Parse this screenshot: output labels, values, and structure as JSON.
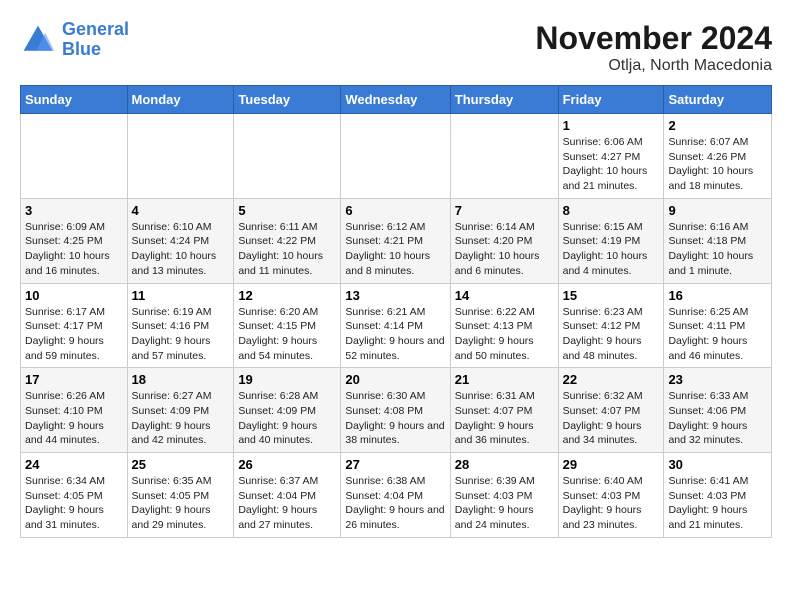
{
  "logo": {
    "line1": "General",
    "line2": "Blue"
  },
  "title": "November 2024",
  "location": "Otlja, North Macedonia",
  "days_of_week": [
    "Sunday",
    "Monday",
    "Tuesday",
    "Wednesday",
    "Thursday",
    "Friday",
    "Saturday"
  ],
  "weeks": [
    [
      {
        "day": "",
        "info": ""
      },
      {
        "day": "",
        "info": ""
      },
      {
        "day": "",
        "info": ""
      },
      {
        "day": "",
        "info": ""
      },
      {
        "day": "",
        "info": ""
      },
      {
        "day": "1",
        "info": "Sunrise: 6:06 AM\nSunset: 4:27 PM\nDaylight: 10 hours and 21 minutes."
      },
      {
        "day": "2",
        "info": "Sunrise: 6:07 AM\nSunset: 4:26 PM\nDaylight: 10 hours and 18 minutes."
      }
    ],
    [
      {
        "day": "3",
        "info": "Sunrise: 6:09 AM\nSunset: 4:25 PM\nDaylight: 10 hours and 16 minutes."
      },
      {
        "day": "4",
        "info": "Sunrise: 6:10 AM\nSunset: 4:24 PM\nDaylight: 10 hours and 13 minutes."
      },
      {
        "day": "5",
        "info": "Sunrise: 6:11 AM\nSunset: 4:22 PM\nDaylight: 10 hours and 11 minutes."
      },
      {
        "day": "6",
        "info": "Sunrise: 6:12 AM\nSunset: 4:21 PM\nDaylight: 10 hours and 8 minutes."
      },
      {
        "day": "7",
        "info": "Sunrise: 6:14 AM\nSunset: 4:20 PM\nDaylight: 10 hours and 6 minutes."
      },
      {
        "day": "8",
        "info": "Sunrise: 6:15 AM\nSunset: 4:19 PM\nDaylight: 10 hours and 4 minutes."
      },
      {
        "day": "9",
        "info": "Sunrise: 6:16 AM\nSunset: 4:18 PM\nDaylight: 10 hours and 1 minute."
      }
    ],
    [
      {
        "day": "10",
        "info": "Sunrise: 6:17 AM\nSunset: 4:17 PM\nDaylight: 9 hours and 59 minutes."
      },
      {
        "day": "11",
        "info": "Sunrise: 6:19 AM\nSunset: 4:16 PM\nDaylight: 9 hours and 57 minutes."
      },
      {
        "day": "12",
        "info": "Sunrise: 6:20 AM\nSunset: 4:15 PM\nDaylight: 9 hours and 54 minutes."
      },
      {
        "day": "13",
        "info": "Sunrise: 6:21 AM\nSunset: 4:14 PM\nDaylight: 9 hours and 52 minutes."
      },
      {
        "day": "14",
        "info": "Sunrise: 6:22 AM\nSunset: 4:13 PM\nDaylight: 9 hours and 50 minutes."
      },
      {
        "day": "15",
        "info": "Sunrise: 6:23 AM\nSunset: 4:12 PM\nDaylight: 9 hours and 48 minutes."
      },
      {
        "day": "16",
        "info": "Sunrise: 6:25 AM\nSunset: 4:11 PM\nDaylight: 9 hours and 46 minutes."
      }
    ],
    [
      {
        "day": "17",
        "info": "Sunrise: 6:26 AM\nSunset: 4:10 PM\nDaylight: 9 hours and 44 minutes."
      },
      {
        "day": "18",
        "info": "Sunrise: 6:27 AM\nSunset: 4:09 PM\nDaylight: 9 hours and 42 minutes."
      },
      {
        "day": "19",
        "info": "Sunrise: 6:28 AM\nSunset: 4:09 PM\nDaylight: 9 hours and 40 minutes."
      },
      {
        "day": "20",
        "info": "Sunrise: 6:30 AM\nSunset: 4:08 PM\nDaylight: 9 hours and 38 minutes."
      },
      {
        "day": "21",
        "info": "Sunrise: 6:31 AM\nSunset: 4:07 PM\nDaylight: 9 hours and 36 minutes."
      },
      {
        "day": "22",
        "info": "Sunrise: 6:32 AM\nSunset: 4:07 PM\nDaylight: 9 hours and 34 minutes."
      },
      {
        "day": "23",
        "info": "Sunrise: 6:33 AM\nSunset: 4:06 PM\nDaylight: 9 hours and 32 minutes."
      }
    ],
    [
      {
        "day": "24",
        "info": "Sunrise: 6:34 AM\nSunset: 4:05 PM\nDaylight: 9 hours and 31 minutes."
      },
      {
        "day": "25",
        "info": "Sunrise: 6:35 AM\nSunset: 4:05 PM\nDaylight: 9 hours and 29 minutes."
      },
      {
        "day": "26",
        "info": "Sunrise: 6:37 AM\nSunset: 4:04 PM\nDaylight: 9 hours and 27 minutes."
      },
      {
        "day": "27",
        "info": "Sunrise: 6:38 AM\nSunset: 4:04 PM\nDaylight: 9 hours and 26 minutes."
      },
      {
        "day": "28",
        "info": "Sunrise: 6:39 AM\nSunset: 4:03 PM\nDaylight: 9 hours and 24 minutes."
      },
      {
        "day": "29",
        "info": "Sunrise: 6:40 AM\nSunset: 4:03 PM\nDaylight: 9 hours and 23 minutes."
      },
      {
        "day": "30",
        "info": "Sunrise: 6:41 AM\nSunset: 4:03 PM\nDaylight: 9 hours and 21 minutes."
      }
    ]
  ]
}
